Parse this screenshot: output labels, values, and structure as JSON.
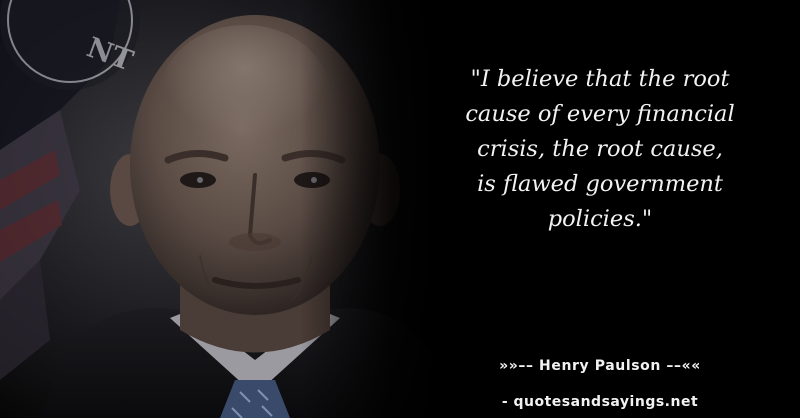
{
  "quote": {
    "lines": [
      "\"I believe that the root",
      "cause of every financial",
      "crisis, the root cause,",
      "is flawed government",
      "policies.\""
    ]
  },
  "attribution": {
    "author_line": "»»–– Henry Paulson ––««",
    "source_line": "- quotesandsayings.net"
  },
  "photo": {
    "subject": "bald-man-portrait"
  },
  "colors": {
    "background": "#000000",
    "text": "#f2f2f2"
  }
}
